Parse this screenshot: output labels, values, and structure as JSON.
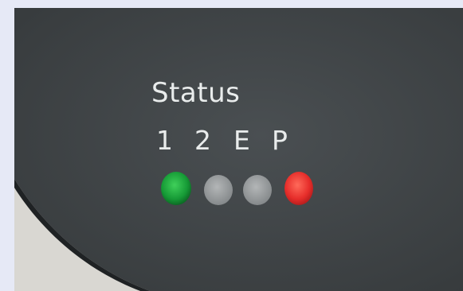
{
  "panel": {
    "title": "Status",
    "channels": [
      {
        "label": "1",
        "led_color": "#1c9b3a",
        "state": "on"
      },
      {
        "label": "2",
        "led_color": "#9a9e9f",
        "state": "off"
      },
      {
        "label": "E",
        "led_color": "#9a9e9f",
        "state": "off"
      },
      {
        "label": "P",
        "led_color": "#e9302e",
        "state": "on"
      }
    ]
  },
  "colors": {
    "background": "#e6e9f6",
    "panel": "#3f4446",
    "text": "#e9ecec"
  }
}
